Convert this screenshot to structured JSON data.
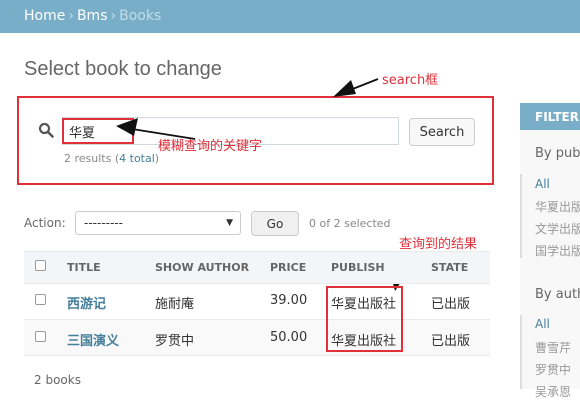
{
  "breadcrumb": {
    "home": "Home",
    "app": "Bms",
    "current": "Books",
    "separator": "›"
  },
  "page": {
    "title": "Select book to change"
  },
  "search": {
    "value": "华夏",
    "button_label": "Search",
    "results_text": "2 results (",
    "total_link": "4 total",
    "results_close": ")"
  },
  "annotations": {
    "search_box": "search框",
    "fuzzy_keyword": "模糊查询的关键字",
    "query_result": "查询到的结果"
  },
  "actions": {
    "label": "Action:",
    "selected_option": "---------",
    "go_label": "Go",
    "selected_text": "0 of 2 selected"
  },
  "table": {
    "columns": [
      "TITLE",
      "SHOW AUTHOR",
      "PRICE",
      "PUBLISH",
      "STATE"
    ],
    "rows": [
      {
        "title": "西游记",
        "author": "施耐庵",
        "price": "39.00",
        "publish": "华夏出版社",
        "state": "已出版"
      },
      {
        "title": "三国演义",
        "author": "罗贯中",
        "price": "50.00",
        "publish": "华夏出版社",
        "state": "已出版"
      }
    ],
    "count_text": "2 books"
  },
  "filter": {
    "header": "FILTER",
    "publish_title": "By publish",
    "publish_items": [
      "All",
      "华夏出版社",
      "文学出版社",
      "国学出版社"
    ],
    "author_title": "By author",
    "author_items": [
      "All",
      "曹雪芹",
      "罗贯中",
      "吴承恩"
    ]
  },
  "colors": {
    "header_bg": "#79aec8",
    "link": "#447e9b",
    "annotation": "#e0303a"
  }
}
